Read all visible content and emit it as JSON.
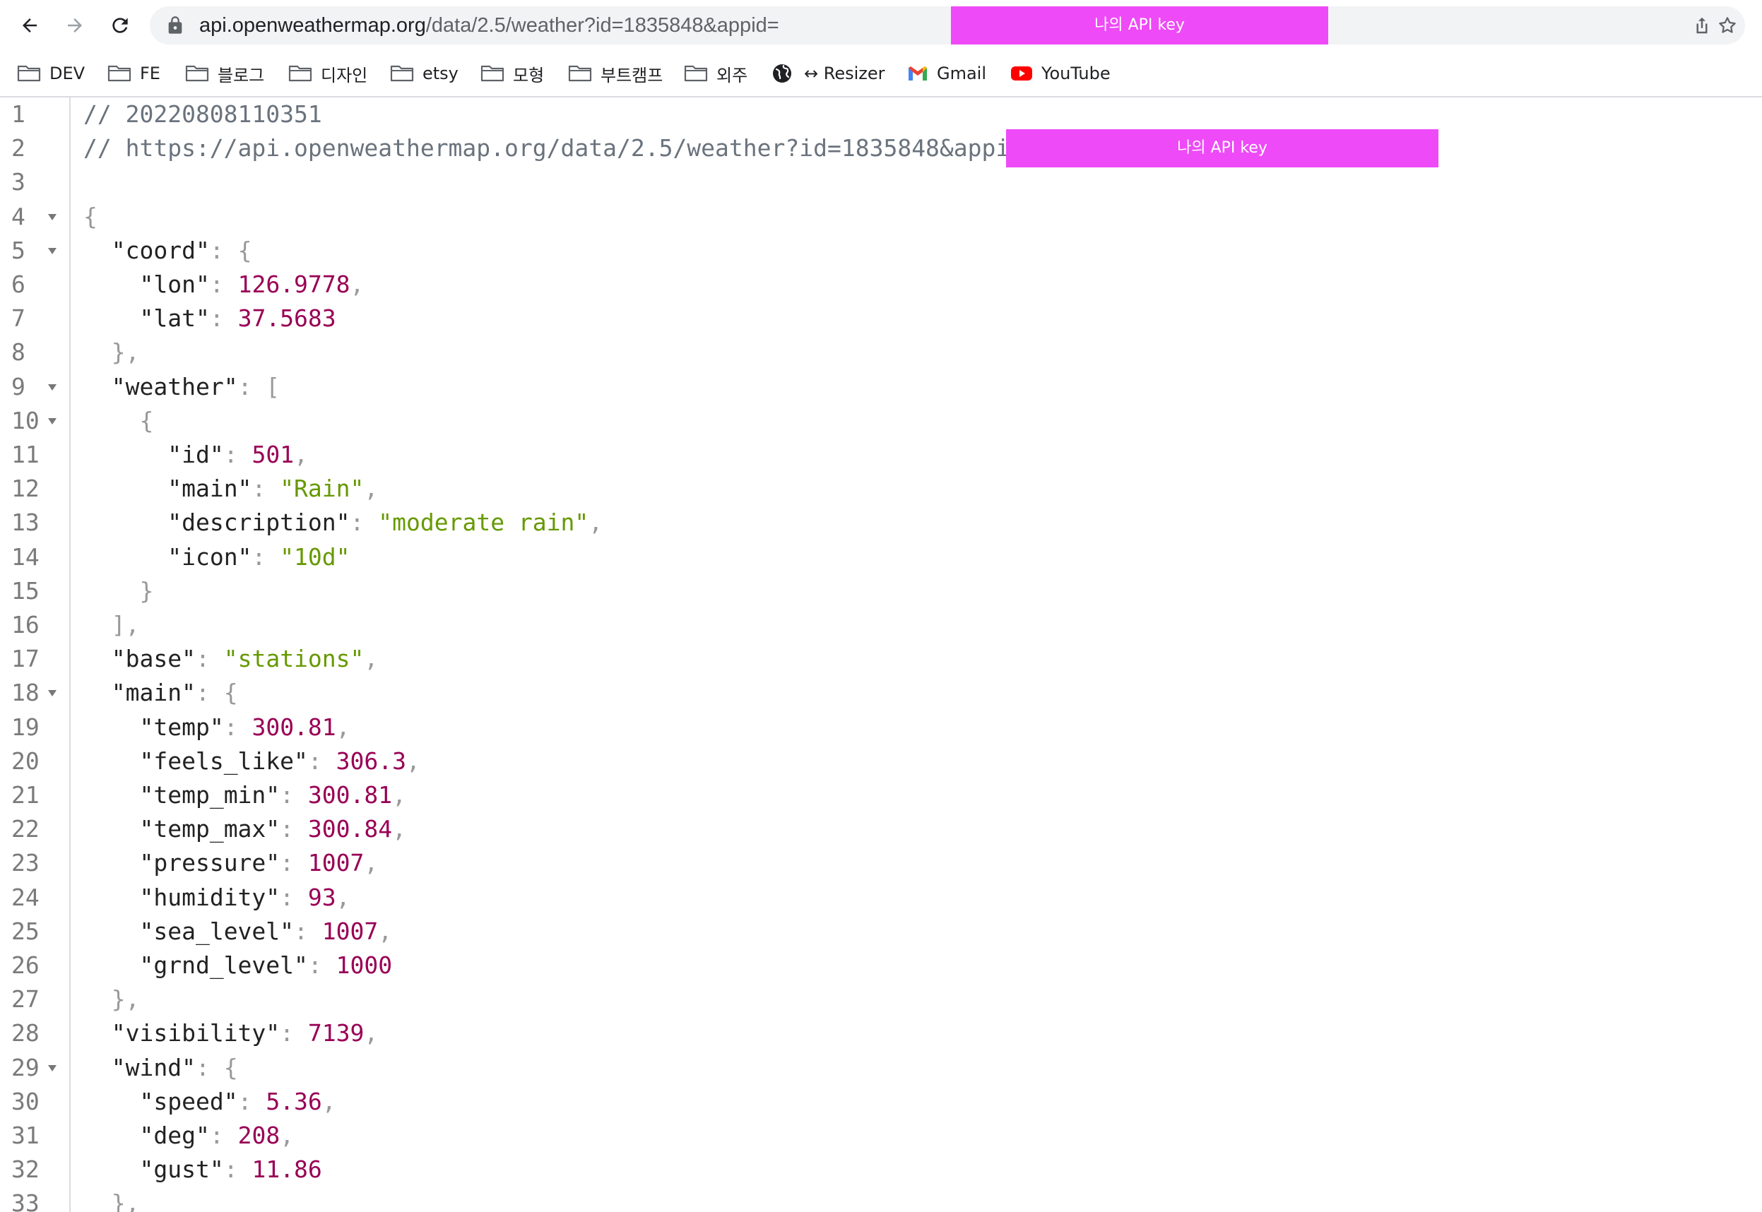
{
  "browser": {
    "url_host": "api.openweathermap.org",
    "url_path": "/data/2.5/weather?id=1835848&appid=",
    "url_redaction_label": "나의 API key",
    "back_icon": "arrow-left-icon",
    "forward_icon": "arrow-right-icon",
    "reload_icon": "reload-icon",
    "lock_icon": "lock-icon",
    "share_icon": "share-icon",
    "star_icon": "star-icon"
  },
  "bookmarks": [
    {
      "label": "DEV",
      "icon": "folder-icon"
    },
    {
      "label": "FE",
      "icon": "folder-icon"
    },
    {
      "label": "블로그",
      "icon": "folder-icon"
    },
    {
      "label": "디자인",
      "icon": "folder-icon"
    },
    {
      "label": "etsy",
      "icon": "folder-icon"
    },
    {
      "label": "모형",
      "icon": "folder-icon"
    },
    {
      "label": "부트캠프",
      "icon": "folder-icon"
    },
    {
      "label": "외주",
      "icon": "folder-icon"
    },
    {
      "label": "",
      "icon": "globe-icon"
    },
    {
      "label": "↔ Resizer",
      "icon": ""
    },
    {
      "label": "Gmail",
      "icon": "gmail-icon"
    },
    {
      "label": "YouTube",
      "icon": "youtube-icon"
    }
  ],
  "colors": {
    "comment": "#6a737d",
    "key": "#222222",
    "punctuation": "#999999",
    "number": "#990055",
    "string": "#669900",
    "redaction": "#ee4af7"
  },
  "code": {
    "redaction_label": "나의 API key",
    "lines": [
      {
        "n": "1",
        "fold": false,
        "indent": 0,
        "type": "comment",
        "text": "// 20220808110351"
      },
      {
        "n": "2",
        "fold": false,
        "indent": 0,
        "type": "comment",
        "text": "// https://api.openweathermap.org/data/2.5/weather?id=1835848&appid="
      },
      {
        "n": "3",
        "fold": false,
        "indent": 0,
        "type": "blank"
      },
      {
        "n": "4",
        "fold": true,
        "indent": 0,
        "type": "open",
        "bracket": "{"
      },
      {
        "n": "5",
        "fold": true,
        "indent": 1,
        "type": "keyopen",
        "key": "coord",
        "bracket": "{"
      },
      {
        "n": "6",
        "fold": false,
        "indent": 2,
        "type": "kv",
        "key": "lon",
        "value": "126.9778",
        "vtype": "num",
        "comma": true
      },
      {
        "n": "7",
        "fold": false,
        "indent": 2,
        "type": "kv",
        "key": "lat",
        "value": "37.5683",
        "vtype": "num",
        "comma": false
      },
      {
        "n": "8",
        "fold": false,
        "indent": 1,
        "type": "close",
        "bracket": "}",
        "comma": true
      },
      {
        "n": "9",
        "fold": true,
        "indent": 1,
        "type": "keyopen",
        "key": "weather",
        "bracket": "["
      },
      {
        "n": "10",
        "fold": true,
        "indent": 2,
        "type": "open",
        "bracket": "{"
      },
      {
        "n": "11",
        "fold": false,
        "indent": 3,
        "type": "kv",
        "key": "id",
        "value": "501",
        "vtype": "num",
        "comma": true
      },
      {
        "n": "12",
        "fold": false,
        "indent": 3,
        "type": "kv",
        "key": "main",
        "value": "\"Rain\"",
        "vtype": "str",
        "comma": true
      },
      {
        "n": "13",
        "fold": false,
        "indent": 3,
        "type": "kv",
        "key": "description",
        "value": "\"moderate rain\"",
        "vtype": "str",
        "comma": true
      },
      {
        "n": "14",
        "fold": false,
        "indent": 3,
        "type": "kv",
        "key": "icon",
        "value": "\"10d\"",
        "vtype": "str",
        "comma": false
      },
      {
        "n": "15",
        "fold": false,
        "indent": 2,
        "type": "close",
        "bracket": "}",
        "comma": false
      },
      {
        "n": "16",
        "fold": false,
        "indent": 1,
        "type": "close",
        "bracket": "]",
        "comma": true
      },
      {
        "n": "17",
        "fold": false,
        "indent": 1,
        "type": "kv",
        "key": "base",
        "value": "\"stations\"",
        "vtype": "str",
        "comma": true
      },
      {
        "n": "18",
        "fold": true,
        "indent": 1,
        "type": "keyopen",
        "key": "main",
        "bracket": "{"
      },
      {
        "n": "19",
        "fold": false,
        "indent": 2,
        "type": "kv",
        "key": "temp",
        "value": "300.81",
        "vtype": "num",
        "comma": true
      },
      {
        "n": "20",
        "fold": false,
        "indent": 2,
        "type": "kv",
        "key": "feels_like",
        "value": "306.3",
        "vtype": "num",
        "comma": true
      },
      {
        "n": "21",
        "fold": false,
        "indent": 2,
        "type": "kv",
        "key": "temp_min",
        "value": "300.81",
        "vtype": "num",
        "comma": true
      },
      {
        "n": "22",
        "fold": false,
        "indent": 2,
        "type": "kv",
        "key": "temp_max",
        "value": "300.84",
        "vtype": "num",
        "comma": true
      },
      {
        "n": "23",
        "fold": false,
        "indent": 2,
        "type": "kv",
        "key": "pressure",
        "value": "1007",
        "vtype": "num",
        "comma": true
      },
      {
        "n": "24",
        "fold": false,
        "indent": 2,
        "type": "kv",
        "key": "humidity",
        "value": "93",
        "vtype": "num",
        "comma": true
      },
      {
        "n": "25",
        "fold": false,
        "indent": 2,
        "type": "kv",
        "key": "sea_level",
        "value": "1007",
        "vtype": "num",
        "comma": true
      },
      {
        "n": "26",
        "fold": false,
        "indent": 2,
        "type": "kv",
        "key": "grnd_level",
        "value": "1000",
        "vtype": "num",
        "comma": false
      },
      {
        "n": "27",
        "fold": false,
        "indent": 1,
        "type": "close",
        "bracket": "}",
        "comma": true
      },
      {
        "n": "28",
        "fold": false,
        "indent": 1,
        "type": "kv",
        "key": "visibility",
        "value": "7139",
        "vtype": "num",
        "comma": true
      },
      {
        "n": "29",
        "fold": true,
        "indent": 1,
        "type": "keyopen",
        "key": "wind",
        "bracket": "{"
      },
      {
        "n": "30",
        "fold": false,
        "indent": 2,
        "type": "kv",
        "key": "speed",
        "value": "5.36",
        "vtype": "num",
        "comma": true
      },
      {
        "n": "31",
        "fold": false,
        "indent": 2,
        "type": "kv",
        "key": "deg",
        "value": "208",
        "vtype": "num",
        "comma": true
      },
      {
        "n": "32",
        "fold": false,
        "indent": 2,
        "type": "kv",
        "key": "gust",
        "value": "11.86",
        "vtype": "num",
        "comma": false
      },
      {
        "n": "33",
        "fold": false,
        "indent": 1,
        "type": "close",
        "bracket": "}",
        "comma": true
      }
    ]
  }
}
